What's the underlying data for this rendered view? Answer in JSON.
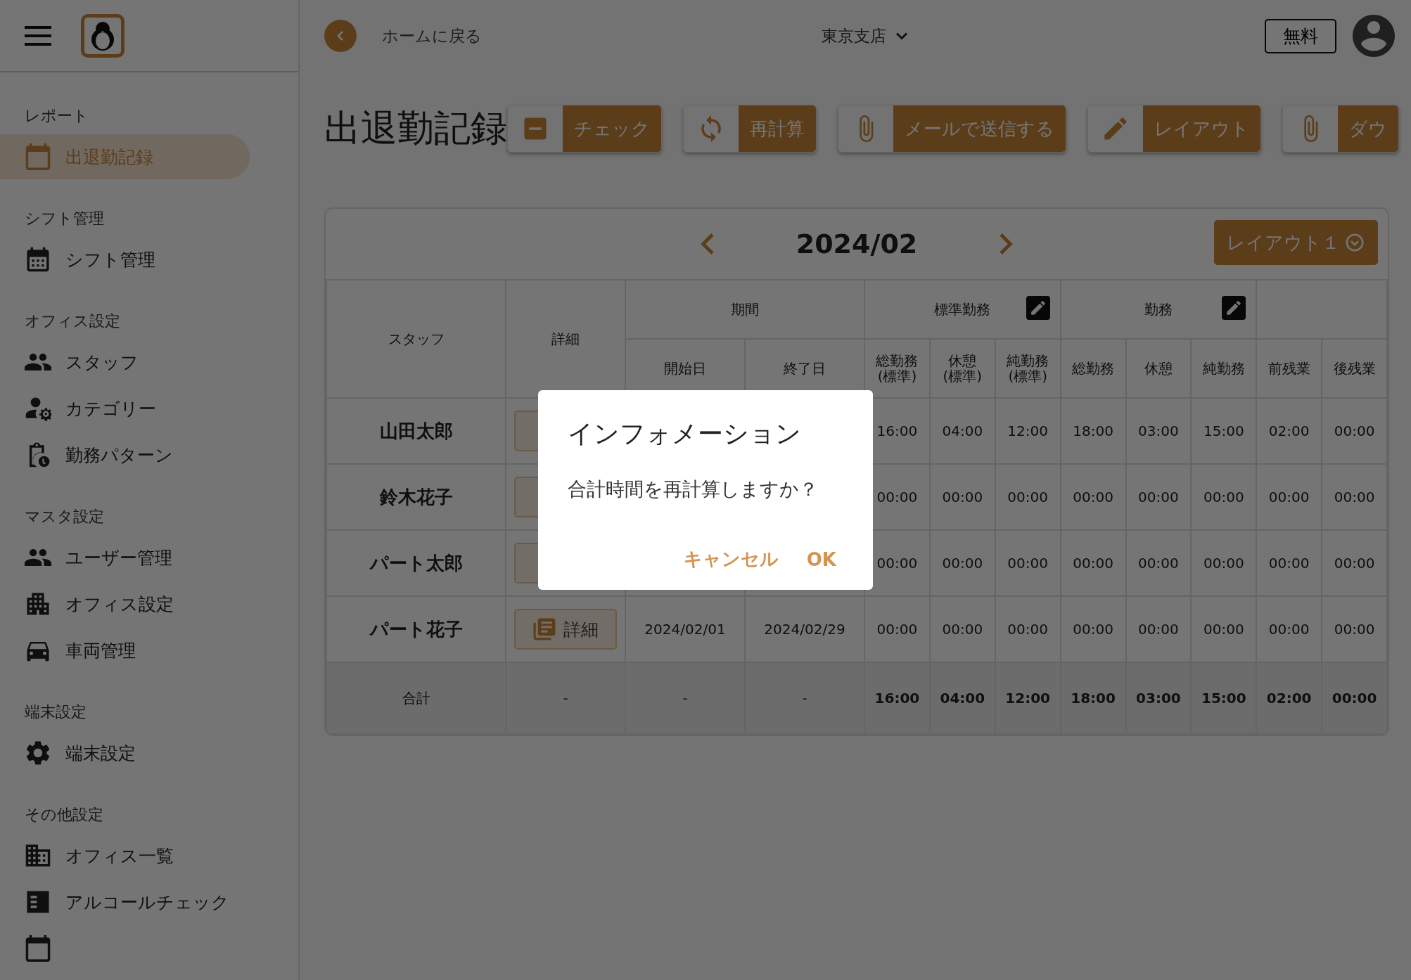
{
  "sidebar": {
    "groups": [
      {
        "heading": "レポート",
        "items": [
          {
            "label": "出退勤記録",
            "selected": true
          }
        ]
      },
      {
        "heading": "シフト管理",
        "items": [
          {
            "label": "シフト管理",
            "selected": false
          }
        ]
      },
      {
        "heading": "オフィス設定",
        "items": [
          {
            "label": "スタッフ",
            "selected": false
          },
          {
            "label": "カテゴリー",
            "selected": false
          },
          {
            "label": "勤務パターン",
            "selected": false
          }
        ]
      },
      {
        "heading": "マスタ設定",
        "items": [
          {
            "label": "ユーザー管理",
            "selected": false
          },
          {
            "label": "オフィス設定",
            "selected": false
          },
          {
            "label": "車両管理",
            "selected": false
          }
        ]
      },
      {
        "heading": "端末設定",
        "items": [
          {
            "label": "端末設定",
            "selected": false
          }
        ]
      },
      {
        "heading": "その他設定",
        "items": [
          {
            "label": "オフィス一覧",
            "selected": false
          },
          {
            "label": "アルコールチェック",
            "selected": false
          },
          {
            "selected": false
          }
        ]
      }
    ]
  },
  "header": {
    "back_label": "ホームに戻る",
    "office": "東京支店",
    "plan": "無料"
  },
  "page_title": "出退勤記録",
  "toolbar": [
    {
      "label": "チェック"
    },
    {
      "label": "再計算"
    },
    {
      "label": "メールで送信する"
    },
    {
      "label": "レイアウト"
    },
    {
      "label": "ダウ"
    }
  ],
  "period": "2024/02",
  "layout_select": "レイアウト１",
  "table": {
    "group_columns": [
      {
        "label": "スタッフ"
      },
      {
        "label": "詳細"
      },
      {
        "label": "期間",
        "editable": false
      },
      {
        "label": "標準勤務",
        "editable": true
      },
      {
        "label": "勤務",
        "editable": true
      },
      {
        "editable": false
      }
    ],
    "columns": [
      "開始日",
      "終了日",
      "総勤務(標準)",
      "休憩(標準)",
      "純勤務(標準)",
      "総勤務",
      "休憩",
      "純勤務",
      "前残業",
      "後残業"
    ],
    "rows": [
      {
        "staff": "山田太郎",
        "values": [
          "16:00",
          "04:00",
          "12:00",
          "18:00",
          "03:00",
          "15:00",
          "02:00",
          "00:00"
        ]
      },
      {
        "staff": "鈴木花子",
        "values": [
          "00:00",
          "00:00",
          "00:00",
          "00:00",
          "00:00",
          "00:00",
          "00:00",
          "00:00"
        ]
      },
      {
        "staff": "パート太郎",
        "values": [
          "00:00",
          "00:00",
          "00:00",
          "00:00",
          "00:00",
          "00:00",
          "00:00",
          "00:00"
        ]
      },
      {
        "staff": "パート花子",
        "detail": "詳細",
        "start": "2024/02/01",
        "end": "2024/02/29",
        "values": [
          "00:00",
          "00:00",
          "00:00",
          "00:00",
          "00:00",
          "00:00",
          "00:00",
          "00:00"
        ]
      }
    ],
    "total": {
      "label": "合計",
      "cells": [
        "-",
        "-",
        "-"
      ],
      "values": [
        "16:00",
        "04:00",
        "12:00",
        "18:00",
        "03:00",
        "15:00",
        "02:00",
        "00:00"
      ]
    }
  },
  "dialog": {
    "title": "インフォメーション",
    "message": "合計時間を再計算しますか？",
    "buttons": [
      "キャンセル",
      "OK"
    ]
  }
}
